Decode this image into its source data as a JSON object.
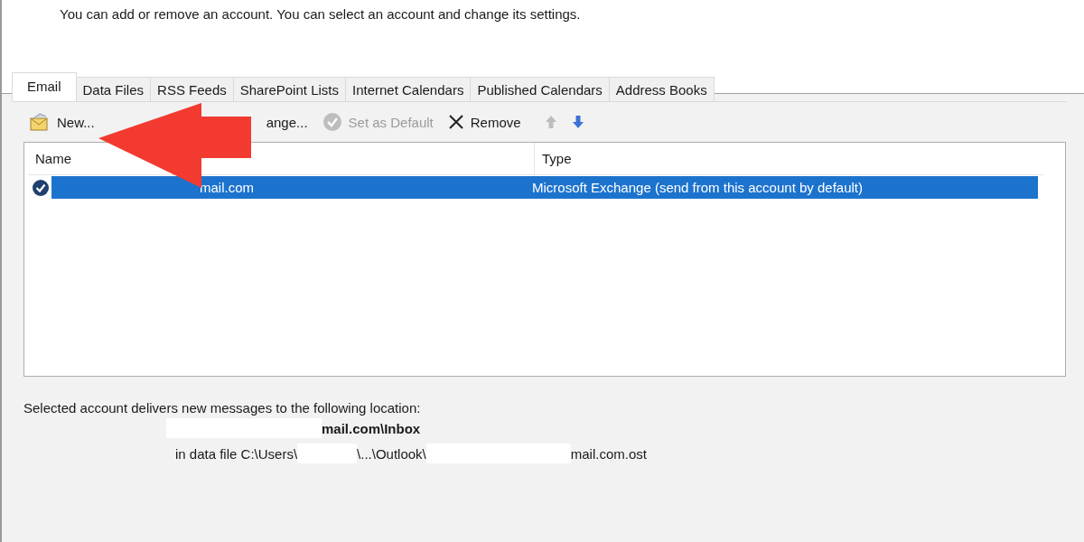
{
  "header": {
    "description": "You can add or remove an account. You can select an account and change its settings."
  },
  "tabs": [
    {
      "label": "Email",
      "selected": true
    },
    {
      "label": "Data Files",
      "selected": false
    },
    {
      "label": "RSS Feeds",
      "selected": false
    },
    {
      "label": "SharePoint Lists",
      "selected": false
    },
    {
      "label": "Internet Calendars",
      "selected": false
    },
    {
      "label": "Published Calendars",
      "selected": false
    },
    {
      "label": "Address Books",
      "selected": false
    }
  ],
  "toolbar": [
    {
      "kind": "new",
      "label": "New...",
      "disabled": false
    },
    {
      "kind": "change",
      "label": "ange...",
      "disabled": false
    },
    {
      "kind": "default",
      "label": "Set as Default",
      "disabled": true
    },
    {
      "kind": "remove",
      "label": "Remove",
      "disabled": false
    },
    {
      "kind": "up",
      "disabled": true
    },
    {
      "kind": "down",
      "disabled": false
    }
  ],
  "accounts": {
    "columns": [
      "Name",
      "Type"
    ],
    "rows": [
      {
        "name": "mail.com",
        "type": "Microsoft Exchange (send from this account by default)",
        "selected": true,
        "default": true
      }
    ]
  },
  "location": {
    "label": "Selected account delivers new messages to the following location:",
    "folder": [
      {
        "kind": "redacted"
      },
      {
        "kind": "text",
        "text": "mail.com\\Inbox"
      }
    ],
    "file": [
      {
        "kind": "text",
        "text": "in data file C:\\Users\\"
      },
      {
        "kind": "redacted"
      },
      {
        "kind": "text",
        "text": "\\...\\Outlook\\"
      },
      {
        "kind": "redacted"
      },
      {
        "kind": "text",
        "text": "mail.com.ost"
      }
    ]
  }
}
